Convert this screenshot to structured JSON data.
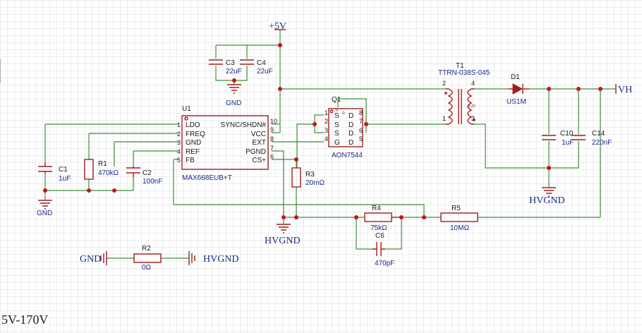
{
  "nets": {
    "vcc": "+5V",
    "vh": "VH",
    "hvgnd_a": "HVGND",
    "hvgnd_b": "HVGND",
    "gnd_net": "GND",
    "hvgnd_net": "HVGND",
    "gnd_c1": "GND",
    "gnd_c34": "GND"
  },
  "components": {
    "u1": {
      "ref": "U1",
      "value": "MAX668EUB+T",
      "pins_left": [
        "LDO",
        "FREQ",
        "GND",
        "REF",
        "FB"
      ],
      "pins_right": [
        "SYNC/SHDN#",
        "VCC",
        "EXT",
        "PGND",
        "CS+"
      ],
      "nums_left": [
        "1",
        "2",
        "3",
        "4",
        "5"
      ],
      "nums_right": [
        "10",
        "9",
        "8",
        "7",
        "6"
      ]
    },
    "q1": {
      "ref": "Q1",
      "value": "AON7544",
      "dlabel": "D",
      "pins_left": [
        "S",
        "S",
        "S",
        "G"
      ],
      "pins_right": [
        "D",
        "D",
        "D",
        "D"
      ],
      "nums_left": [
        "1",
        "2",
        "3",
        "4"
      ],
      "nums_right": [
        "8",
        "7",
        "6",
        "5"
      ],
      "pad": "9"
    },
    "t1": {
      "ref": "T1",
      "value": "TTRN-038S-045",
      "pins": [
        "2",
        "4",
        "1",
        "3"
      ],
      "tag": "8.22"
    },
    "d1": {
      "ref": "D1",
      "value": "US1M"
    },
    "c1": {
      "ref": "C1",
      "value": "1uF"
    },
    "c2": {
      "ref": "C2",
      "value": "100nF"
    },
    "c3": {
      "ref": "C3",
      "value": "22uF"
    },
    "c4": {
      "ref": "C4",
      "value": "22uF"
    },
    "c6": {
      "ref": "C6",
      "value": "470pF"
    },
    "c10": {
      "ref": "C10",
      "value": "1uF"
    },
    "c14": {
      "ref": "C14",
      "value": "220nF"
    },
    "r1": {
      "ref": "R1",
      "value": "470kΩ"
    },
    "r2": {
      "ref": "R2",
      "value": "0Ω"
    },
    "r3": {
      "ref": "R3",
      "value": "20mΩ"
    },
    "r4": {
      "ref": "R4",
      "value": "75kΩ"
    },
    "r5": {
      "ref": "R5",
      "value": "10MΩ"
    }
  },
  "footer": "5V-170V",
  "colors": {
    "wire": "#3f8f3f",
    "component": "#a31c1c",
    "junction": "#c81414",
    "value_text": "#1a2a8a"
  }
}
